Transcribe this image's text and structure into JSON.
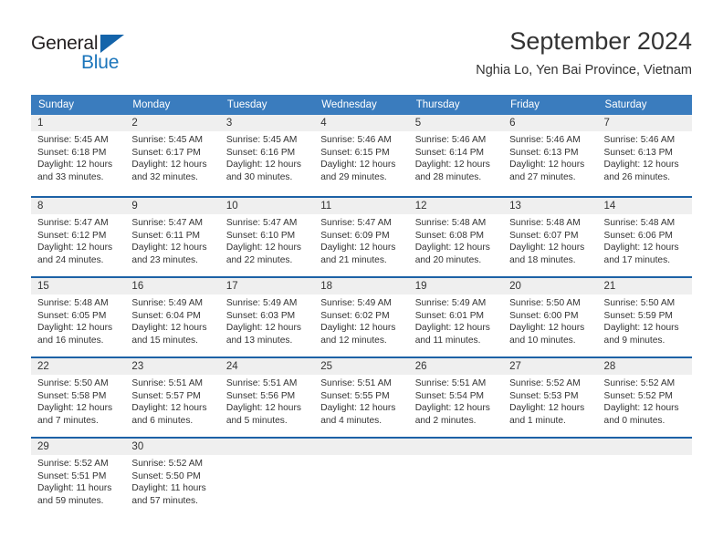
{
  "brand": {
    "name_top": "General",
    "name_bottom": "Blue",
    "accent_color": "#1b75bb",
    "triangle_color": "#1464aa"
  },
  "header": {
    "title": "September 2024",
    "location": "Nghia Lo, Yen Bai Province, Vietnam"
  },
  "calendar": {
    "header_bg": "#3a7cbe",
    "row_divider_color": "#1d62a6",
    "day_band_color": "#efefef",
    "weekdays": [
      "Sunday",
      "Monday",
      "Tuesday",
      "Wednesday",
      "Thursday",
      "Friday",
      "Saturday"
    ],
    "weeks": [
      [
        {
          "day": "1",
          "sunrise": "Sunrise: 5:45 AM",
          "sunset": "Sunset: 6:18 PM",
          "daylight1": "Daylight: 12 hours",
          "daylight2": "and 33 minutes."
        },
        {
          "day": "2",
          "sunrise": "Sunrise: 5:45 AM",
          "sunset": "Sunset: 6:17 PM",
          "daylight1": "Daylight: 12 hours",
          "daylight2": "and 32 minutes."
        },
        {
          "day": "3",
          "sunrise": "Sunrise: 5:45 AM",
          "sunset": "Sunset: 6:16 PM",
          "daylight1": "Daylight: 12 hours",
          "daylight2": "and 30 minutes."
        },
        {
          "day": "4",
          "sunrise": "Sunrise: 5:46 AM",
          "sunset": "Sunset: 6:15 PM",
          "daylight1": "Daylight: 12 hours",
          "daylight2": "and 29 minutes."
        },
        {
          "day": "5",
          "sunrise": "Sunrise: 5:46 AM",
          "sunset": "Sunset: 6:14 PM",
          "daylight1": "Daylight: 12 hours",
          "daylight2": "and 28 minutes."
        },
        {
          "day": "6",
          "sunrise": "Sunrise: 5:46 AM",
          "sunset": "Sunset: 6:13 PM",
          "daylight1": "Daylight: 12 hours",
          "daylight2": "and 27 minutes."
        },
        {
          "day": "7",
          "sunrise": "Sunrise: 5:46 AM",
          "sunset": "Sunset: 6:13 PM",
          "daylight1": "Daylight: 12 hours",
          "daylight2": "and 26 minutes."
        }
      ],
      [
        {
          "day": "8",
          "sunrise": "Sunrise: 5:47 AM",
          "sunset": "Sunset: 6:12 PM",
          "daylight1": "Daylight: 12 hours",
          "daylight2": "and 24 minutes."
        },
        {
          "day": "9",
          "sunrise": "Sunrise: 5:47 AM",
          "sunset": "Sunset: 6:11 PM",
          "daylight1": "Daylight: 12 hours",
          "daylight2": "and 23 minutes."
        },
        {
          "day": "10",
          "sunrise": "Sunrise: 5:47 AM",
          "sunset": "Sunset: 6:10 PM",
          "daylight1": "Daylight: 12 hours",
          "daylight2": "and 22 minutes."
        },
        {
          "day": "11",
          "sunrise": "Sunrise: 5:47 AM",
          "sunset": "Sunset: 6:09 PM",
          "daylight1": "Daylight: 12 hours",
          "daylight2": "and 21 minutes."
        },
        {
          "day": "12",
          "sunrise": "Sunrise: 5:48 AM",
          "sunset": "Sunset: 6:08 PM",
          "daylight1": "Daylight: 12 hours",
          "daylight2": "and 20 minutes."
        },
        {
          "day": "13",
          "sunrise": "Sunrise: 5:48 AM",
          "sunset": "Sunset: 6:07 PM",
          "daylight1": "Daylight: 12 hours",
          "daylight2": "and 18 minutes."
        },
        {
          "day": "14",
          "sunrise": "Sunrise: 5:48 AM",
          "sunset": "Sunset: 6:06 PM",
          "daylight1": "Daylight: 12 hours",
          "daylight2": "and 17 minutes."
        }
      ],
      [
        {
          "day": "15",
          "sunrise": "Sunrise: 5:48 AM",
          "sunset": "Sunset: 6:05 PM",
          "daylight1": "Daylight: 12 hours",
          "daylight2": "and 16 minutes."
        },
        {
          "day": "16",
          "sunrise": "Sunrise: 5:49 AM",
          "sunset": "Sunset: 6:04 PM",
          "daylight1": "Daylight: 12 hours",
          "daylight2": "and 15 minutes."
        },
        {
          "day": "17",
          "sunrise": "Sunrise: 5:49 AM",
          "sunset": "Sunset: 6:03 PM",
          "daylight1": "Daylight: 12 hours",
          "daylight2": "and 13 minutes."
        },
        {
          "day": "18",
          "sunrise": "Sunrise: 5:49 AM",
          "sunset": "Sunset: 6:02 PM",
          "daylight1": "Daylight: 12 hours",
          "daylight2": "and 12 minutes."
        },
        {
          "day": "19",
          "sunrise": "Sunrise: 5:49 AM",
          "sunset": "Sunset: 6:01 PM",
          "daylight1": "Daylight: 12 hours",
          "daylight2": "and 11 minutes."
        },
        {
          "day": "20",
          "sunrise": "Sunrise: 5:50 AM",
          "sunset": "Sunset: 6:00 PM",
          "daylight1": "Daylight: 12 hours",
          "daylight2": "and 10 minutes."
        },
        {
          "day": "21",
          "sunrise": "Sunrise: 5:50 AM",
          "sunset": "Sunset: 5:59 PM",
          "daylight1": "Daylight: 12 hours",
          "daylight2": "and 9 minutes."
        }
      ],
      [
        {
          "day": "22",
          "sunrise": "Sunrise: 5:50 AM",
          "sunset": "Sunset: 5:58 PM",
          "daylight1": "Daylight: 12 hours",
          "daylight2": "and 7 minutes."
        },
        {
          "day": "23",
          "sunrise": "Sunrise: 5:51 AM",
          "sunset": "Sunset: 5:57 PM",
          "daylight1": "Daylight: 12 hours",
          "daylight2": "and 6 minutes."
        },
        {
          "day": "24",
          "sunrise": "Sunrise: 5:51 AM",
          "sunset": "Sunset: 5:56 PM",
          "daylight1": "Daylight: 12 hours",
          "daylight2": "and 5 minutes."
        },
        {
          "day": "25",
          "sunrise": "Sunrise: 5:51 AM",
          "sunset": "Sunset: 5:55 PM",
          "daylight1": "Daylight: 12 hours",
          "daylight2": "and 4 minutes."
        },
        {
          "day": "26",
          "sunrise": "Sunrise: 5:51 AM",
          "sunset": "Sunset: 5:54 PM",
          "daylight1": "Daylight: 12 hours",
          "daylight2": "and 2 minutes."
        },
        {
          "day": "27",
          "sunrise": "Sunrise: 5:52 AM",
          "sunset": "Sunset: 5:53 PM",
          "daylight1": "Daylight: 12 hours",
          "daylight2": "and 1 minute."
        },
        {
          "day": "28",
          "sunrise": "Sunrise: 5:52 AM",
          "sunset": "Sunset: 5:52 PM",
          "daylight1": "Daylight: 12 hours",
          "daylight2": "and 0 minutes."
        }
      ],
      [
        {
          "day": "29",
          "sunrise": "Sunrise: 5:52 AM",
          "sunset": "Sunset: 5:51 PM",
          "daylight1": "Daylight: 11 hours",
          "daylight2": "and 59 minutes."
        },
        {
          "day": "30",
          "sunrise": "Sunrise: 5:52 AM",
          "sunset": "Sunset: 5:50 PM",
          "daylight1": "Daylight: 11 hours",
          "daylight2": "and 57 minutes."
        },
        {
          "day": "",
          "sunrise": "",
          "sunset": "",
          "daylight1": "",
          "daylight2": ""
        },
        {
          "day": "",
          "sunrise": "",
          "sunset": "",
          "daylight1": "",
          "daylight2": ""
        },
        {
          "day": "",
          "sunrise": "",
          "sunset": "",
          "daylight1": "",
          "daylight2": ""
        },
        {
          "day": "",
          "sunrise": "",
          "sunset": "",
          "daylight1": "",
          "daylight2": ""
        },
        {
          "day": "",
          "sunrise": "",
          "sunset": "",
          "daylight1": "",
          "daylight2": ""
        }
      ]
    ]
  }
}
